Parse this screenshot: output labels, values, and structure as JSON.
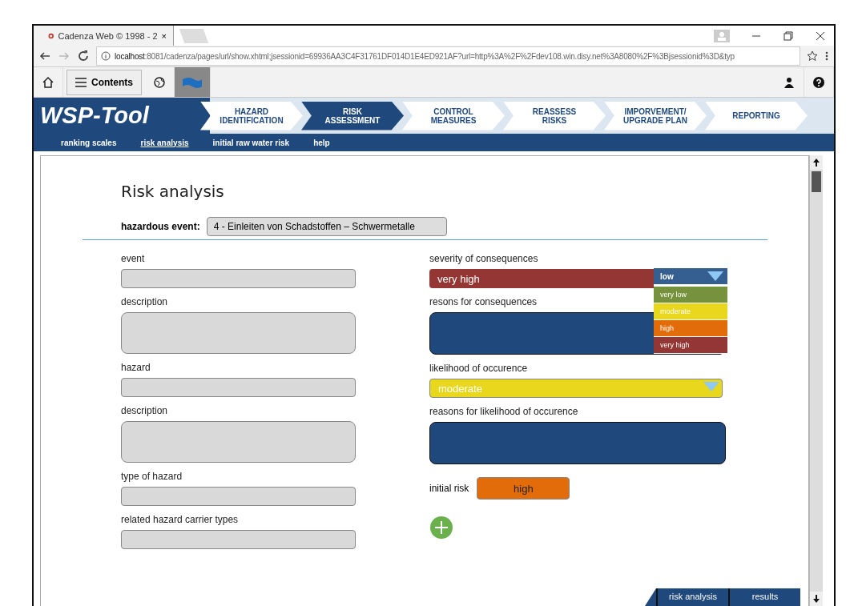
{
  "browser": {
    "tab_title": "Cadenza Web © 1998 - 2",
    "tab_close": "×",
    "url_host": "localhost",
    "url_rest": ":8081/cadenza/pages/url/show.xhtml;jsessionid=69936AA3C4F31761DF014D1E4ED921AF?url=http%3A%2F%2Fdev108.win.disy.net%3A8080%2F%3Bjsessionid%3D&typ"
  },
  "toolbar": {
    "contents_label": "Contents"
  },
  "banner": {
    "logo": "WSP-Tool",
    "steps": [
      {
        "label": "HAZARD\nIDENTIFICATION",
        "selected": false
      },
      {
        "label": "RISK\nASSESSMENT",
        "selected": true
      },
      {
        "label": "CONTROL\nMEASURES",
        "selected": false
      },
      {
        "label": "REASSESS\nRISKS",
        "selected": false
      },
      {
        "label": "IMPORVEMENT/\nUPGRADE PLAN",
        "selected": false
      },
      {
        "label": "REPORTING",
        "selected": false
      }
    ]
  },
  "subnav": [
    {
      "label": "ranking scales",
      "selected": false
    },
    {
      "label": "risk analysis",
      "selected": true
    },
    {
      "label": "initial  raw water risk",
      "selected": false
    },
    {
      "label": "help",
      "selected": false
    }
  ],
  "page": {
    "title": "Risk analysis",
    "hazardous_event_label": "hazardous event:",
    "hazardous_event_value": "4 -  Einleiten von Schadstoffen – Schwermetalle",
    "left_fields": [
      {
        "label": "event",
        "kind": "line"
      },
      {
        "label": "description",
        "kind": "area"
      },
      {
        "label": "hazard",
        "kind": "line"
      },
      {
        "label": "description",
        "kind": "area"
      },
      {
        "label": "type of hazard",
        "kind": "line"
      },
      {
        "label": "related hazard  carrier types",
        "kind": "line"
      }
    ],
    "severity": {
      "label": "severity of consequences",
      "value": "very high",
      "color": "#943634",
      "options": [
        {
          "label": "low",
          "color": "#365f91"
        },
        {
          "label": "very low",
          "color": "#76923c"
        },
        {
          "label": "moderate",
          "color": "#e8d71c"
        },
        {
          "label": "high",
          "color": "#e36c0a"
        },
        {
          "label": "very high",
          "color": "#943634"
        }
      ]
    },
    "consequences_reasons": {
      "label": "resons for consequences"
    },
    "likelihood": {
      "label": "likelihood of occurence",
      "value": "moderate",
      "color": "#e8d71c"
    },
    "likelihood_reasons": {
      "label": "reasons for likelihood of occurence"
    },
    "initial_risk": {
      "label": "initial risk",
      "value": "high",
      "color": "#e36c0a"
    }
  },
  "bottom_tabs": [
    {
      "label": "risk analysis"
    },
    {
      "label": "results"
    }
  ]
}
